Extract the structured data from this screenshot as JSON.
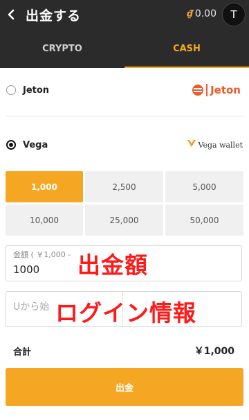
{
  "header": {
    "title": "出金する",
    "balance_symbol": "₫",
    "balance": "0.00",
    "avatar_initial": "T",
    "back_icon": "chevron-left-icon"
  },
  "tabs": [
    {
      "label": "CRYPTO",
      "active": false
    },
    {
      "label": "CASH",
      "active": true
    }
  ],
  "methods": [
    {
      "label": "Jeton",
      "logo_text": "Jeton",
      "selected": false
    },
    {
      "label": "Vega",
      "logo_text": "Vega wallet",
      "selected": true
    }
  ],
  "amounts": [
    "1,000",
    "2,500",
    "5,000",
    "10,000",
    "25,000",
    "50,000"
  ],
  "selected_amount": "1,000",
  "amount_field": {
    "label": "金額 ( ￥1,000 - ",
    "value": "1000"
  },
  "login_field": {
    "placeholder": "Uから始"
  },
  "overlays": {
    "amount_note": "出金額",
    "login_note": "ログイン情報"
  },
  "total": {
    "label": "合計",
    "value": "￥1,000"
  },
  "submit_label": "出金",
  "colors": {
    "accent": "#f5a623",
    "header_bg": "#2b2b2b",
    "jeton": "#ee5b2a",
    "overlay_red": "#ff1a1a"
  }
}
